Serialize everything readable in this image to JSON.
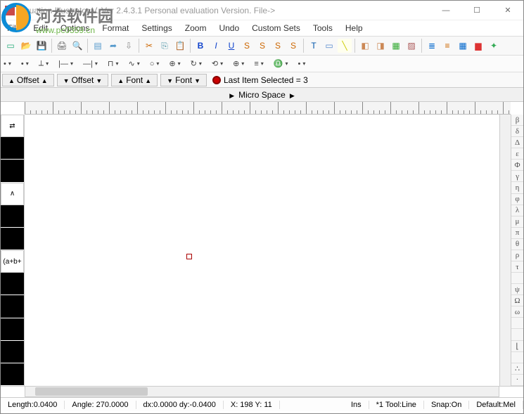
{
  "window": {
    "title": "Equation Illustrator V. Ver 2.4.3.1 Personal evaluation Version. File->",
    "controls": {
      "min": "—",
      "max": "☐",
      "close": "✕"
    }
  },
  "watermark": {
    "text": "河东软件园",
    "url": "www.pc0359.cn"
  },
  "menu": [
    "File",
    "Edit",
    "Options",
    "Format",
    "Settings",
    "Zoom",
    "Undo",
    "Custom Sets",
    "Tools",
    "Help"
  ],
  "toolbar1": [
    {
      "name": "new-icon",
      "glyph": "▭",
      "color": "#2a7"
    },
    {
      "name": "open-icon",
      "glyph": "📂",
      "color": "#d90"
    },
    {
      "name": "save-icon",
      "glyph": "💾",
      "color": "#359"
    },
    {
      "name": "sep"
    },
    {
      "name": "print-icon",
      "glyph": "🖨",
      "color": "#666"
    },
    {
      "name": "preview-icon",
      "glyph": "🔍",
      "color": "#666"
    },
    {
      "name": "sep"
    },
    {
      "name": "doc-icon",
      "glyph": "▤",
      "color": "#59c"
    },
    {
      "name": "export-icon",
      "glyph": "➦",
      "color": "#59c"
    },
    {
      "name": "import-icon",
      "glyph": "⇩",
      "color": "#888"
    },
    {
      "name": "sep"
    },
    {
      "name": "cut-icon",
      "glyph": "✂",
      "color": "#c60"
    },
    {
      "name": "copy-icon",
      "glyph": "⎘",
      "color": "#59a"
    },
    {
      "name": "paste-icon",
      "glyph": "📋",
      "color": "#c90"
    },
    {
      "name": "sep"
    },
    {
      "name": "bold-icon",
      "glyph": "B",
      "color": "#14c",
      "bold": true
    },
    {
      "name": "italic-icon",
      "glyph": "I",
      "color": "#14c",
      "italic": true
    },
    {
      "name": "underline-icon",
      "glyph": "U",
      "color": "#14c",
      "under": true
    },
    {
      "name": "style-s1-icon",
      "glyph": "S",
      "color": "#c60"
    },
    {
      "name": "style-s2-icon",
      "glyph": "S",
      "color": "#c60"
    },
    {
      "name": "style-s3-icon",
      "glyph": "S",
      "color": "#c60"
    },
    {
      "name": "style-s4-icon",
      "glyph": "S",
      "color": "#c60"
    },
    {
      "name": "sep"
    },
    {
      "name": "text-tool-icon",
      "glyph": "T",
      "color": "#05a"
    },
    {
      "name": "select-icon",
      "glyph": "▭",
      "color": "#58c"
    },
    {
      "name": "line-tool-icon",
      "glyph": "╲",
      "color": "#cc0",
      "bg": "#ffe"
    },
    {
      "name": "sep"
    },
    {
      "name": "shape1-icon",
      "glyph": "◧",
      "color": "#c85"
    },
    {
      "name": "shape2-icon",
      "glyph": "◨",
      "color": "#c85"
    },
    {
      "name": "group-icon",
      "glyph": "▦",
      "color": "#3a3"
    },
    {
      "name": "ungroup-icon",
      "glyph": "▨",
      "color": "#a55"
    },
    {
      "name": "sep"
    },
    {
      "name": "align1-icon",
      "glyph": "≣",
      "color": "#06c"
    },
    {
      "name": "align2-icon",
      "glyph": "≡",
      "color": "#c60"
    },
    {
      "name": "grid-icon",
      "glyph": "▦",
      "color": "#06c"
    },
    {
      "name": "color-icon",
      "glyph": "▆",
      "color": "#d33"
    },
    {
      "name": "palette-icon",
      "glyph": "✦",
      "color": "#3a5"
    }
  ],
  "toolbar2": [
    {
      "name": "drop-a",
      "glyph": "•"
    },
    {
      "name": "drop-b",
      "glyph": "•"
    },
    {
      "name": "drop-c",
      "glyph": "⟂"
    },
    {
      "name": "drop-d",
      "glyph": "|—"
    },
    {
      "name": "drop-e",
      "glyph": "—|"
    },
    {
      "name": "drop-f",
      "glyph": "⊓"
    },
    {
      "name": "drop-g",
      "glyph": "∿"
    },
    {
      "name": "drop-h",
      "glyph": "○"
    },
    {
      "name": "drop-i",
      "glyph": "⊕"
    },
    {
      "name": "drop-j",
      "glyph": "↻"
    },
    {
      "name": "drop-k",
      "glyph": "⟲"
    },
    {
      "name": "drop-l",
      "glyph": "⊕"
    },
    {
      "name": "drop-m",
      "glyph": "≡"
    },
    {
      "name": "drop-n",
      "glyph": "♎"
    },
    {
      "name": "drop-o",
      "glyph": "•"
    }
  ],
  "controlbar": {
    "offset_up": "Offset",
    "offset_dn": "Offset",
    "font_up": "Font",
    "font_dn": "Font",
    "status_label": "Last Item Selected = 3"
  },
  "microspace": "Micro Space",
  "leftpanel": [
    {
      "name": "lp-arrows",
      "text": "⇄",
      "white": true
    },
    {
      "name": "lp-1",
      "text": ""
    },
    {
      "name": "lp-2",
      "text": ""
    },
    {
      "name": "lp-lambda",
      "text": "∧",
      "white": true
    },
    {
      "name": "lp-3",
      "text": ""
    },
    {
      "name": "lp-4",
      "text": ""
    },
    {
      "name": "lp-expr",
      "text": "(a+b+",
      "white": true
    },
    {
      "name": "lp-5",
      "text": ""
    },
    {
      "name": "lp-6",
      "text": ""
    },
    {
      "name": "lp-7",
      "text": ""
    },
    {
      "name": "lp-8",
      "text": ""
    },
    {
      "name": "lp-9",
      "text": ""
    }
  ],
  "rightpanel": [
    "β",
    "δ",
    "Δ",
    "ε",
    "Φ",
    "γ",
    "η",
    "φ",
    "λ",
    "μ",
    "π",
    "θ",
    "ρ",
    "τ",
    "",
    "ψ",
    "Ω",
    "ω",
    "",
    "",
    "⌊",
    "",
    "∴",
    "·"
  ],
  "statusbar": {
    "length": "Length:0.0400",
    "angle": "Angle: 270.0000",
    "dxy": "dx:0.0000  dy:-0.0400",
    "xy": "X: 198 Y: 11",
    "ins": "Ins",
    "tool": "*1 Tool:Line",
    "snap": "Snap:On",
    "default": "Default:Mel"
  }
}
